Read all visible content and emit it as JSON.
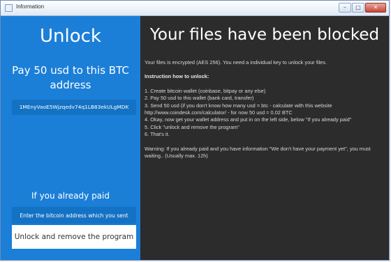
{
  "window": {
    "title": "Information",
    "controls": {
      "minimize": "–",
      "maximize": "□",
      "close": "✕"
    }
  },
  "left_panel": {
    "heading": "Unlock",
    "instruction": "Pay 50 usd to this BTC address",
    "btc_address": "1MEnyVaoE5Wjzqedv74q1LB83ekULgMDK",
    "paid_label": "If you already paid",
    "address_placeholder": "Enter the bitcoin address which you sent",
    "unlock_button": "Unlock and remove the program"
  },
  "right_panel": {
    "heading": "Your files have been blocked",
    "intro": "Your files is encrypted (AES 256). You need a individual key to unlock your files.",
    "instructions_title": "Instruction how to unlock:",
    "steps": [
      "1. Create bitcoin wallet (coinbase, bitpay or any else)",
      "2. Pay 50 usd to this wallet (bank card, transfer)",
      "3. Send 50 usd (if you don't know how many usd = btc - calculate with this website http://www.coindesk.com/calculator/ - for now 50 usd = 0.02 BTC",
      "4. Okay, now get your wallet address and put in on the left side, below \"If you already paid\"",
      "5. Click \"unlock and remove the program\"",
      "6. That's it."
    ],
    "warning": "Warning: If you already paid and you have information \"We don't have your payment yet\", you must waiting.. (Usually max. 12h)"
  },
  "colors": {
    "left_bg": "#1b7fd8",
    "right_bg": "#2c2c2c",
    "field_bg": "#1472c4",
    "button_bg": "#ffffff"
  }
}
